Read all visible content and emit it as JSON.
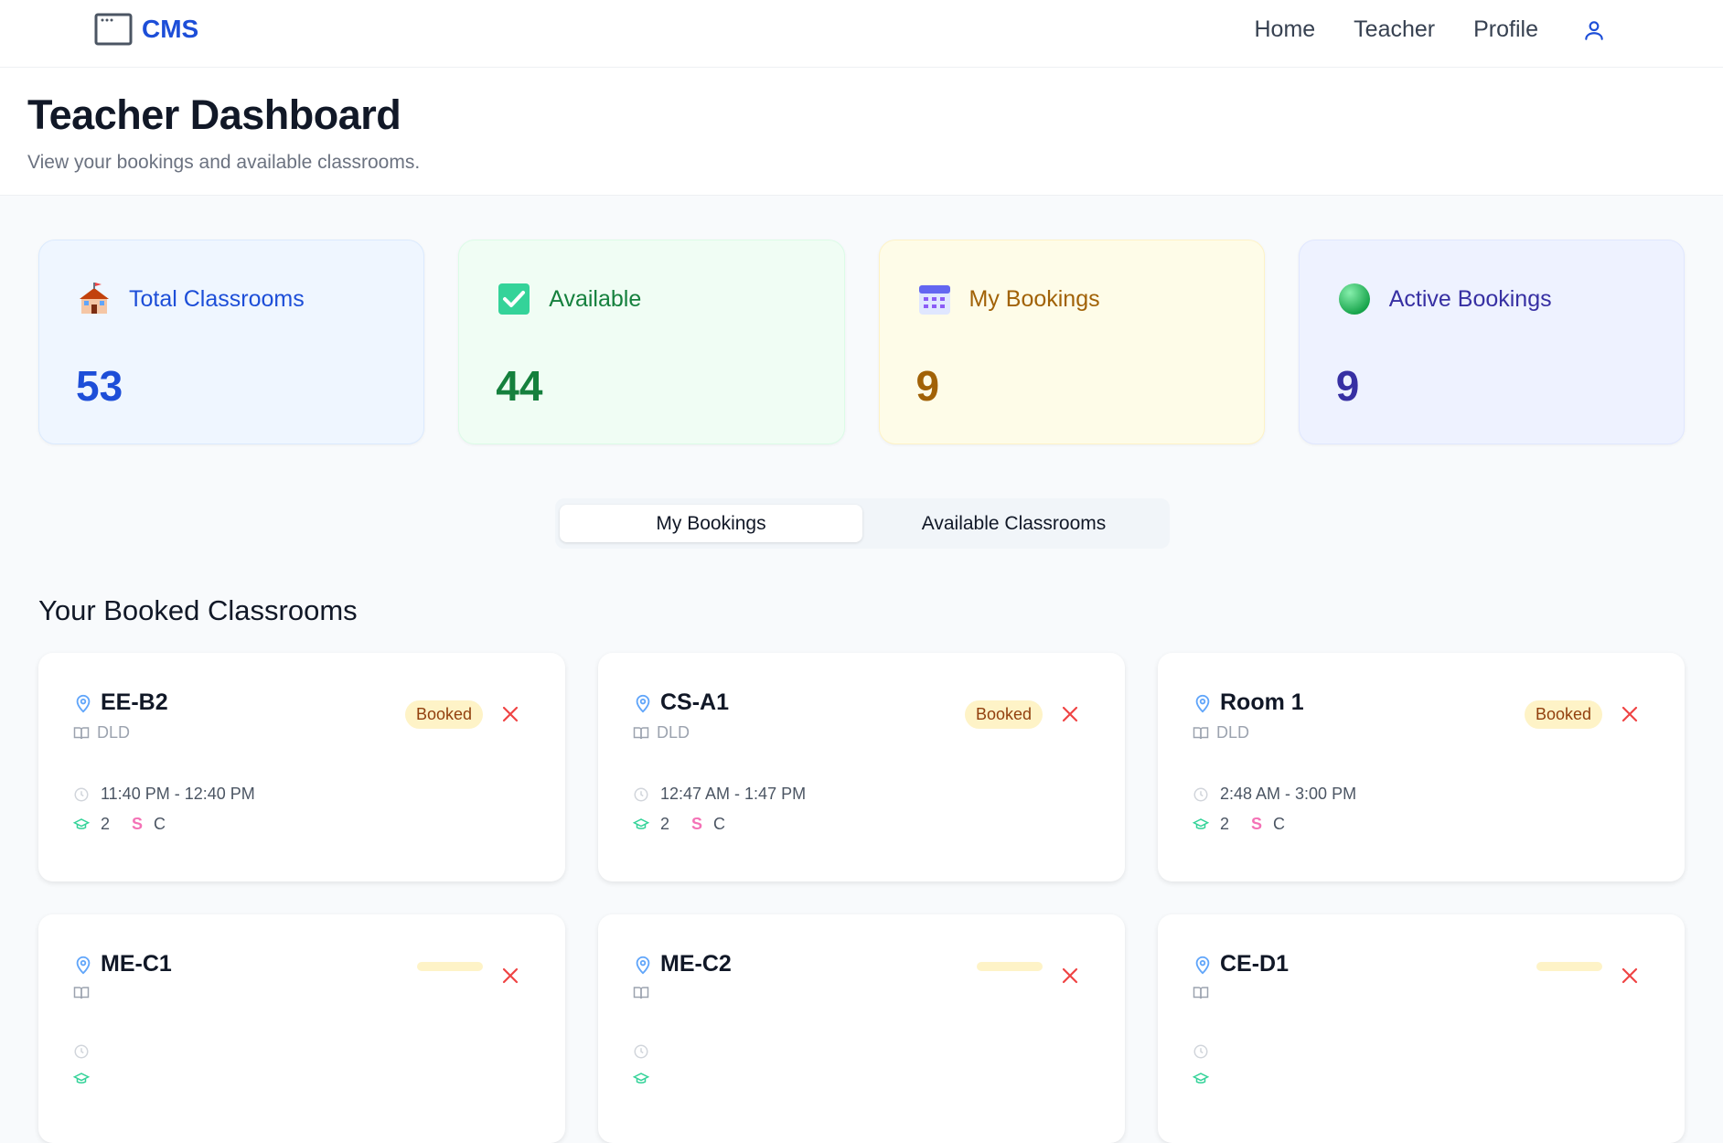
{
  "nav": {
    "brand": "CMS",
    "links": [
      "Home",
      "Teacher",
      "Profile"
    ]
  },
  "header": {
    "title": "Teacher Dashboard",
    "subtitle": "View your bookings and available classrooms."
  },
  "stats": [
    {
      "label": "Total Classrooms",
      "value": "53",
      "icon": "school-icon",
      "color": "#1d4ed8"
    },
    {
      "label": "Available",
      "value": "44",
      "icon": "check-box-icon",
      "color": "#15803d"
    },
    {
      "label": "My Bookings",
      "value": "9",
      "icon": "calendar-icon",
      "color": "#a16207"
    },
    {
      "label": "Active Bookings",
      "value": "9",
      "icon": "green-circle-icon",
      "color": "#3730a3"
    }
  ],
  "tabs": {
    "my_bookings": "My Bookings",
    "available_classrooms": "Available Classrooms",
    "active": "my_bookings"
  },
  "section": {
    "title": "Your Booked Classrooms"
  },
  "bookings": [
    {
      "room": "EE-B2",
      "subject": "DLD",
      "status": "Booked",
      "time": "11:40 PM - 12:40 PM",
      "cap": "2",
      "s": "S",
      "c": "C"
    },
    {
      "room": "CS-A1",
      "subject": "DLD",
      "status": "Booked",
      "time": "12:47 AM - 1:47 PM",
      "cap": "2",
      "s": "S",
      "c": "C"
    },
    {
      "room": "Room 1",
      "subject": "DLD",
      "status": "Booked",
      "time": "2:48 AM - 3:00 PM",
      "cap": "2",
      "s": "S",
      "c": "C"
    },
    {
      "room": "ME-C1",
      "subject": "",
      "status": "",
      "time": "",
      "cap": "",
      "s": "",
      "c": ""
    },
    {
      "room": "ME-C2",
      "subject": "",
      "status": "",
      "time": "",
      "cap": "",
      "s": "",
      "c": ""
    },
    {
      "room": "CE-D1",
      "subject": "",
      "status": "",
      "time": "",
      "cap": "",
      "s": "",
      "c": ""
    }
  ],
  "colors": {
    "brand": "#1d4ed8",
    "badge_bg": "#fef3c7",
    "badge_text": "#92400e",
    "cancel": "#ef4444"
  }
}
